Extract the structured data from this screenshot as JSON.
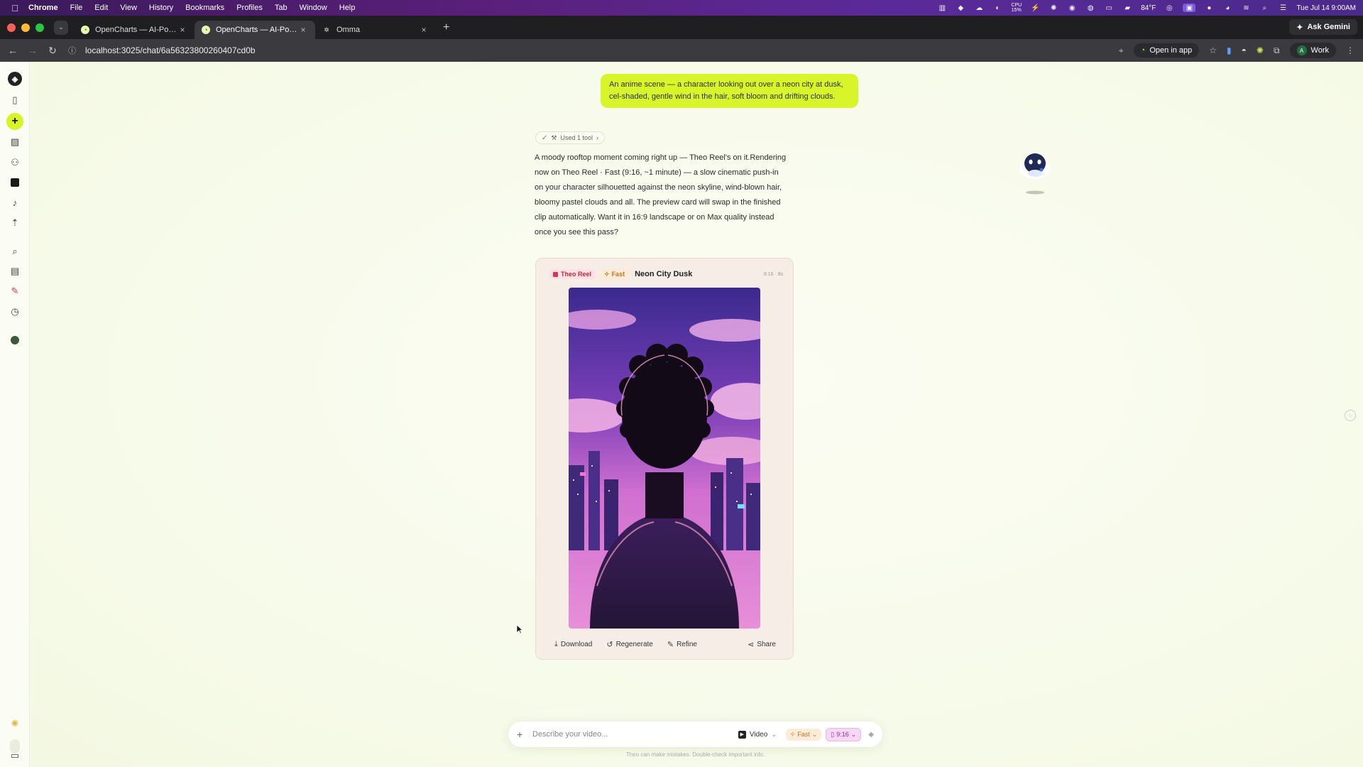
{
  "menubar": {
    "app": "Chrome",
    "items": [
      "File",
      "Edit",
      "View",
      "History",
      "Bookmarks",
      "Profiles",
      "Tab",
      "Window",
      "Help"
    ],
    "cpu_label": "CPU",
    "cpu_value": "15%",
    "temperature": "84°F",
    "datetime": "Tue Jul 14  9:00AM"
  },
  "tabs": [
    {
      "title": "OpenCharts — AI-Powered F",
      "active": false
    },
    {
      "title": "OpenCharts — AI-Powered F",
      "active": true
    },
    {
      "title": "Omma",
      "active": false
    }
  ],
  "ask_gemini": "Ask Gemini",
  "toolbar": {
    "url": "localhost:3025/chat/6a56323800260407cd0b",
    "open_in_app": "Open in app",
    "profile": "Work",
    "profile_initial": "A"
  },
  "conversation": {
    "user_prompt": "An anime scene — a character looking out over a neon city at dusk, cel-shaded, gentle wind in the hair, soft bloom and drifting clouds.",
    "tool_chip": "Used 1 tool",
    "reply": "A moody rooftop moment coming right up — Theo Reel's on it.Rendering now on Theo Reel · Fast (9:16, ~1 minute) — a slow cinematic push-in on your character silhouetted against the neon skyline, wind-blown hair, bloomy pastel clouds and all. The preview card will swap in the finished clip automatically. Want it in 16:9 landscape or on Max quality instead once you see this pass?"
  },
  "video_card": {
    "model_badge": "Theo Reel",
    "speed_badge": "Fast",
    "title": "Neon City Dusk",
    "meta": "9:16 · 8s",
    "actions": {
      "download": "Download",
      "regenerate": "Regenerate",
      "refine": "Refine",
      "share": "Share"
    }
  },
  "composer": {
    "placeholder": "Describe your video...",
    "mode": "Video",
    "speed": "Fast",
    "ratio": "9:16"
  },
  "disclaimer": "Theo can make mistakes. Double-check important info.",
  "colors": {
    "accent_lime": "#d8f52a",
    "menubar_purple": "#5a1f7a",
    "badge_red": "#c8253b",
    "badge_orange": "#c5761f"
  }
}
